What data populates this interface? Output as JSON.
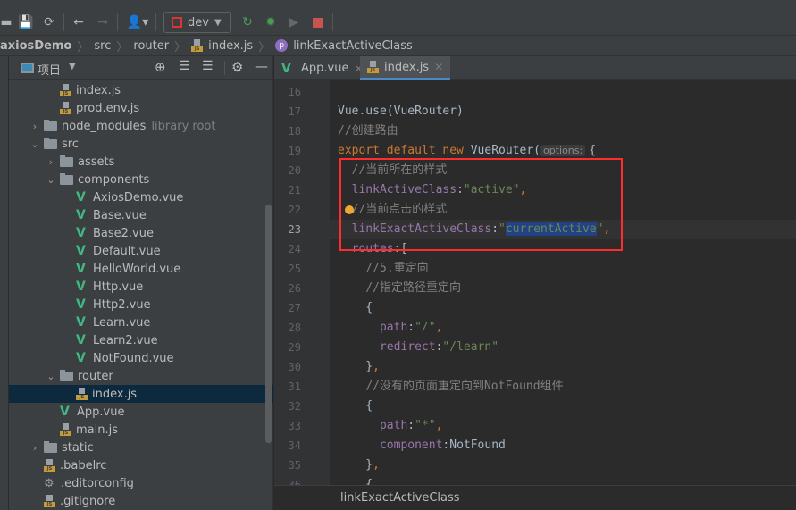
{
  "toolbar": {
    "run_config": "dev"
  },
  "breadcrumb": [
    "axiosDemo",
    "src",
    "router",
    "index.js",
    "linkExactActiveClass"
  ],
  "project_panel": {
    "title": "项目"
  },
  "tree": [
    {
      "level": 1,
      "icon": "js",
      "label": "index.js"
    },
    {
      "level": 1,
      "icon": "js",
      "label": "prod.env.js"
    },
    {
      "level": 0,
      "icon": "folder",
      "arrow": "right",
      "label": "node_modules",
      "hint": "library root"
    },
    {
      "level": 0,
      "icon": "folder",
      "arrow": "down",
      "label": "src"
    },
    {
      "level": 1,
      "icon": "folder",
      "arrow": "right",
      "label": "assets"
    },
    {
      "level": 1,
      "icon": "folder",
      "arrow": "down",
      "label": "components"
    },
    {
      "level": 2,
      "icon": "vue",
      "label": "AxiosDemo.vue"
    },
    {
      "level": 2,
      "icon": "vue",
      "label": "Base.vue"
    },
    {
      "level": 2,
      "icon": "vue",
      "label": "Base2.vue"
    },
    {
      "level": 2,
      "icon": "vue",
      "label": "Default.vue"
    },
    {
      "level": 2,
      "icon": "vue",
      "label": "HelloWorld.vue"
    },
    {
      "level": 2,
      "icon": "vue",
      "label": "Http.vue"
    },
    {
      "level": 2,
      "icon": "vue",
      "label": "Http2.vue"
    },
    {
      "level": 2,
      "icon": "vue",
      "label": "Learn.vue"
    },
    {
      "level": 2,
      "icon": "vue",
      "label": "Learn2.vue"
    },
    {
      "level": 2,
      "icon": "vue",
      "label": "NotFound.vue"
    },
    {
      "level": 1,
      "icon": "folder",
      "arrow": "down",
      "label": "router"
    },
    {
      "level": 2,
      "icon": "js",
      "label": "index.js",
      "selected": true
    },
    {
      "level": 1,
      "icon": "vue",
      "label": "App.vue"
    },
    {
      "level": 1,
      "icon": "js",
      "label": "main.js"
    },
    {
      "level": 0,
      "icon": "folder",
      "arrow": "right",
      "label": "static"
    },
    {
      "level": 0,
      "icon": "config",
      "label": ".babelrc"
    },
    {
      "level": 0,
      "icon": "gear",
      "label": ".editorconfig"
    },
    {
      "level": 0,
      "icon": "config",
      "label": ".gitignore"
    }
  ],
  "tabs": [
    {
      "label": "App.vue",
      "icon": "vue"
    },
    {
      "label": "index.js",
      "icon": "js",
      "active": true
    }
  ],
  "code_lines": [
    {
      "n": 16,
      "tokens": []
    },
    {
      "n": 17,
      "tokens": [
        [
          "def",
          "Vue.use(VueRouter)"
        ]
      ]
    },
    {
      "n": 18,
      "tokens": [
        [
          "cm",
          "//创建路由"
        ]
      ]
    },
    {
      "n": 19,
      "tokens": [
        [
          "kw",
          "export default new "
        ],
        [
          "def",
          "VueRouter("
        ],
        [
          "hint",
          "options:"
        ],
        [
          "def",
          "{"
        ]
      ]
    },
    {
      "n": 20,
      "tokens": [
        [
          "def",
          "  "
        ],
        [
          "cm",
          "//当前所在的样式"
        ]
      ]
    },
    {
      "n": 21,
      "tokens": [
        [
          "def",
          "  "
        ],
        [
          "prop",
          "linkActiveClass"
        ],
        [
          "def",
          ":"
        ],
        [
          "str",
          "\"active\""
        ],
        [
          "kw",
          ","
        ]
      ]
    },
    {
      "n": 22,
      "tokens": [
        [
          "def",
          "  "
        ],
        [
          "cm",
          "//当前点击的样式"
        ]
      ]
    },
    {
      "n": 23,
      "current": true,
      "tokens": [
        [
          "def",
          "  "
        ],
        [
          "prop",
          "linkExactActiveClass"
        ],
        [
          "def",
          ":"
        ],
        [
          "str",
          "\""
        ],
        [
          "sel",
          "currentActive"
        ],
        [
          "str",
          "\""
        ],
        [
          "kw",
          ","
        ]
      ]
    },
    {
      "n": 24,
      "tokens": [
        [
          "def",
          "  "
        ],
        [
          "prop",
          "routes"
        ],
        [
          "def",
          ":["
        ]
      ]
    },
    {
      "n": 25,
      "tokens": [
        [
          "def",
          "    "
        ],
        [
          "cm",
          "//5.重定向"
        ]
      ]
    },
    {
      "n": 26,
      "tokens": [
        [
          "def",
          "    "
        ],
        [
          "cm",
          "//指定路径重定向"
        ]
      ]
    },
    {
      "n": 27,
      "tokens": [
        [
          "def",
          "    {"
        ]
      ]
    },
    {
      "n": 28,
      "tokens": [
        [
          "def",
          "      "
        ],
        [
          "prop",
          "path"
        ],
        [
          "def",
          ":"
        ],
        [
          "str",
          "\"/\""
        ],
        [
          "kw",
          ","
        ]
      ]
    },
    {
      "n": 29,
      "tokens": [
        [
          "def",
          "      "
        ],
        [
          "prop",
          "redirect"
        ],
        [
          "def",
          ":"
        ],
        [
          "str",
          "\"/learn\""
        ]
      ]
    },
    {
      "n": 30,
      "tokens": [
        [
          "def",
          "    }"
        ],
        [
          "kw",
          ","
        ]
      ]
    },
    {
      "n": 31,
      "tokens": [
        [
          "def",
          "    "
        ],
        [
          "cm",
          "//没有的页面重定向到NotFound组件"
        ]
      ]
    },
    {
      "n": 32,
      "tokens": [
        [
          "def",
          "    {"
        ]
      ]
    },
    {
      "n": 33,
      "tokens": [
        [
          "def",
          "      "
        ],
        [
          "prop",
          "path"
        ],
        [
          "def",
          ":"
        ],
        [
          "str",
          "\"*\""
        ],
        [
          "kw",
          ","
        ]
      ]
    },
    {
      "n": 34,
      "tokens": [
        [
          "def",
          "      "
        ],
        [
          "prop",
          "component"
        ],
        [
          "def",
          ":NotFound"
        ]
      ]
    },
    {
      "n": 35,
      "tokens": [
        [
          "def",
          "    }"
        ],
        [
          "kw",
          ","
        ]
      ]
    },
    {
      "n": 36,
      "tokens": [
        [
          "def",
          "    {"
        ]
      ]
    }
  ],
  "status_breadcrumb": "linkExactActiveClass",
  "colors": {
    "keyword": "#cc7832",
    "property": "#9876aa",
    "string": "#6a8759",
    "comment": "#808080",
    "selection": "#214283",
    "highlight_box": "#ff2d2d"
  }
}
